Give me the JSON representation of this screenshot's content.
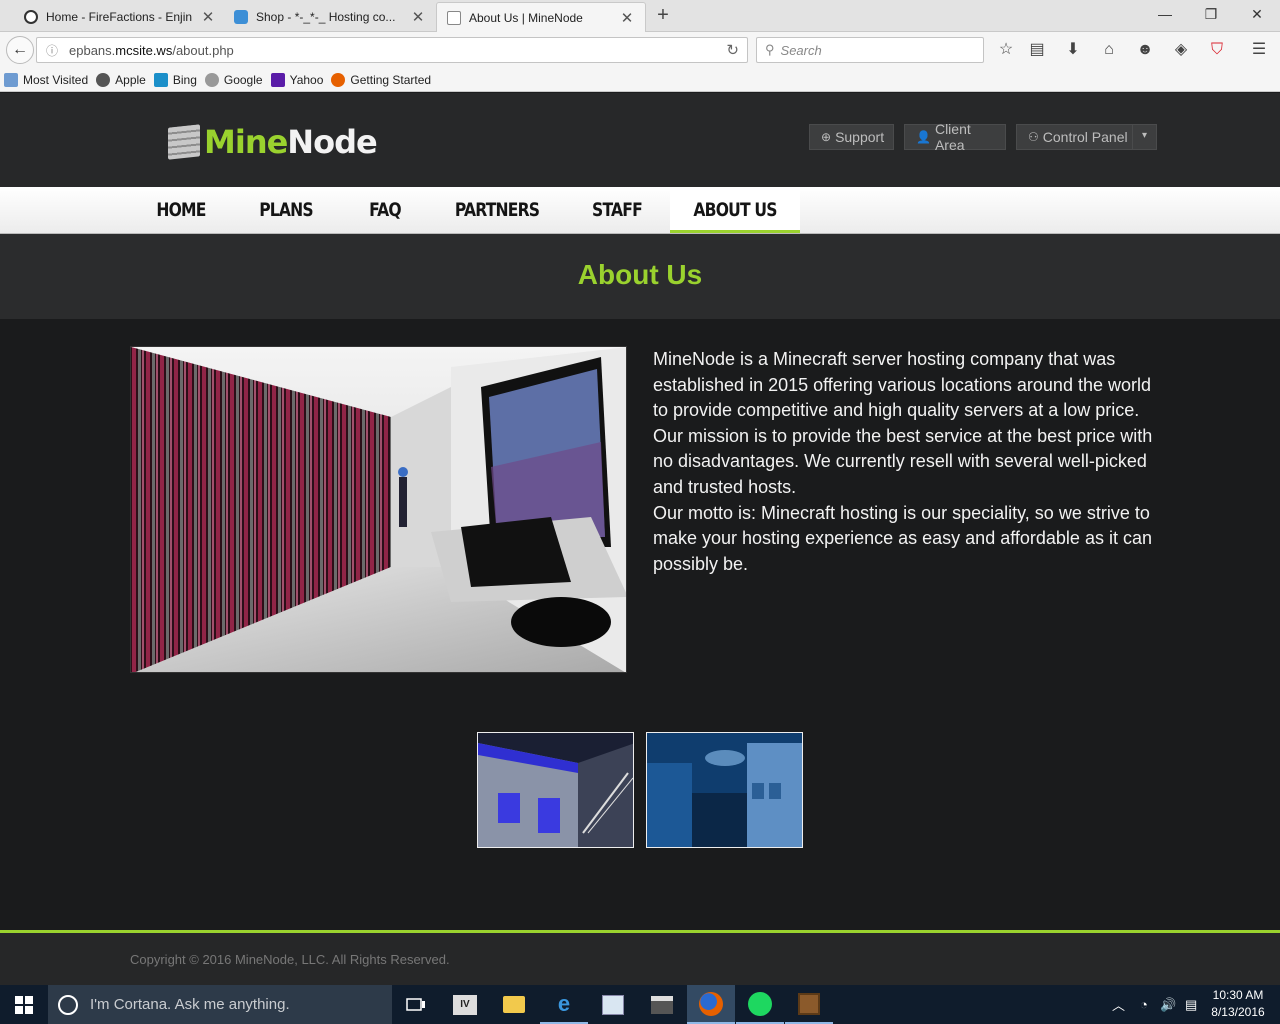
{
  "browser": {
    "tabs": [
      {
        "title": "Home - FireFactions - Enjin",
        "close": "✕"
      },
      {
        "title": "Shop - *-_*-_ Hosting co...",
        "close": "✕"
      },
      {
        "title": "About Us | MineNode",
        "close": "✕"
      }
    ],
    "new_tab": "+",
    "window_controls": {
      "minimize": "—",
      "restore": "❐",
      "close": "✕"
    },
    "url_prefix": "epbans.",
    "url_domain": "mcsite.ws",
    "url_path": "/about.php",
    "search_placeholder": "Search",
    "bookmarks": [
      "Most Visited",
      "Apple",
      "Bing",
      "Google",
      "Yahoo",
      "Getting Started"
    ]
  },
  "site": {
    "logo_mine": "Mine",
    "logo_node": "Node",
    "header_buttons": {
      "support": "Support",
      "client_area": "Client Area",
      "control_panel": "Control Panel"
    },
    "nav": [
      "HOME",
      "PLANS",
      "FAQ",
      "PARTNERS",
      "STAFF",
      "ABOUT US"
    ],
    "active_nav": "ABOUT US",
    "page_title": "About Us",
    "about_paragraphs": [
      "MineNode is a Minecraft server hosting company that was established in 2015 offering various locations around the world to provide competitive and high quality servers at a low price.",
      "Our mission is to provide the best service at the best price with no disadvantages. We currently resell with several well-picked and trusted hosts.",
      "Our motto is: Minecraft hosting is our speciality, so we strive to make your hosting experience as easy and affordable as it can possibly be."
    ],
    "copyright": "Copyright © 2016 MineNode, LLC. All Rights Reserved.",
    "colors": {
      "accent": "#9ad22e",
      "header_bg": "#272829",
      "content_bg": "#1a1b1c"
    }
  },
  "taskbar": {
    "cortana_placeholder": "I'm Cortana. Ask me anything.",
    "time": "10:30 AM",
    "date": "8/13/2016"
  }
}
